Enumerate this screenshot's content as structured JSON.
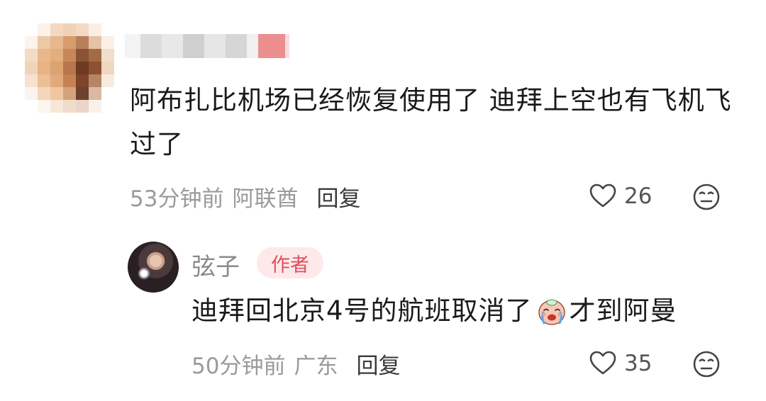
{
  "comment": {
    "text": "阿布扎比机场已经恢复使用了 迪拜上空也有飞机飞过了",
    "time": "53分钟前",
    "location": "阿联酋",
    "reply_label": "回复",
    "likes": "26",
    "like_icon": "heart-outline-icon",
    "dislike_icon": "dislike-face-icon"
  },
  "reply": {
    "author": "弦子",
    "badge": "作者",
    "text_before": "迪拜回北京4号的航班取消了",
    "emoji": "crying-face-emoji",
    "text_after": "才到阿曼",
    "time": "50分钟前",
    "location": "广东",
    "reply_label": "回复",
    "likes": "35"
  },
  "colors": {
    "badge_bg": "#fde9ea",
    "badge_text": "#e0505e",
    "meta_gray": "#9a9a9a"
  }
}
